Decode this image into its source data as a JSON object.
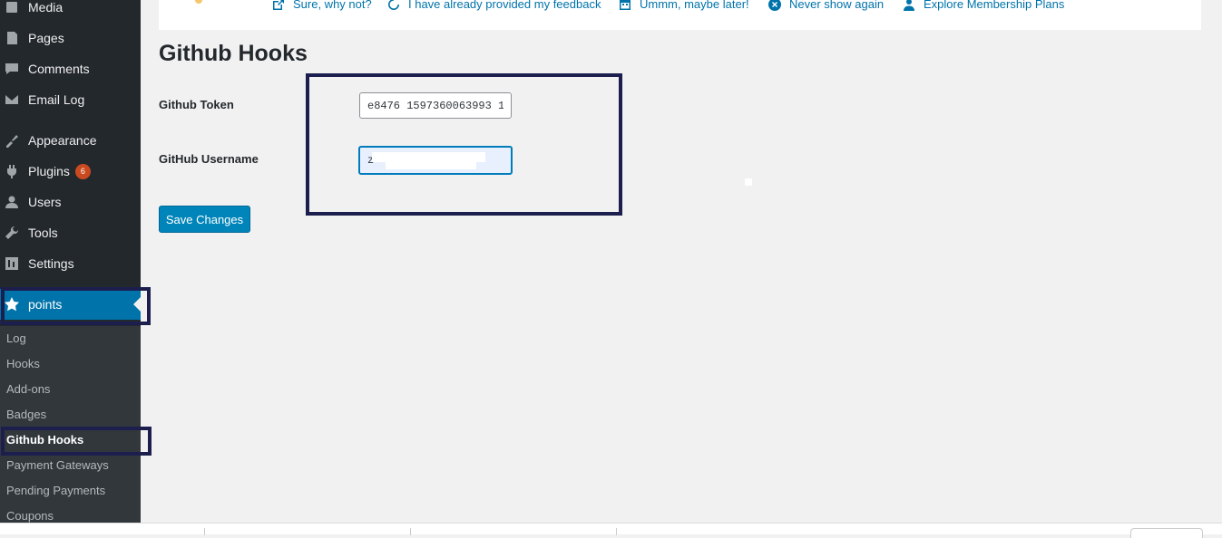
{
  "sidebar": {
    "menu": [
      {
        "label": "Media",
        "icon": "media-icon"
      },
      {
        "label": "Pages",
        "icon": "pages-icon"
      },
      {
        "label": "Comments",
        "icon": "comments-icon"
      },
      {
        "label": "Email Log",
        "icon": "email-icon"
      },
      {
        "label": "Appearance",
        "icon": "appearance-icon"
      },
      {
        "label": "Plugins",
        "icon": "plugins-icon",
        "badge": "6"
      },
      {
        "label": "Users",
        "icon": "users-icon"
      },
      {
        "label": "Tools",
        "icon": "tools-icon"
      },
      {
        "label": "Settings",
        "icon": "settings-icon"
      },
      {
        "label": "points",
        "icon": "star-icon"
      }
    ],
    "submenu": [
      "Log",
      "Hooks",
      "Add-ons",
      "Badges",
      "Github Hooks",
      "Payment Gateways",
      "Pending Payments",
      "Coupons"
    ]
  },
  "notice": {
    "links": [
      {
        "label": "Sure, why not?",
        "icon": "external-link-icon"
      },
      {
        "label": "I have already provided my feedback",
        "icon": "refresh-icon"
      },
      {
        "label": "Ummm, maybe later!",
        "icon": "calendar-icon"
      },
      {
        "label": "Never show again",
        "icon": "close-circle-icon"
      },
      {
        "label": "Explore Membership Plans",
        "icon": "users-icon"
      }
    ]
  },
  "main": {
    "title": "Github Hooks",
    "token_label": "Github Token",
    "token_value": "e8476 1597360063993 1",
    "username_label": "GitHub Username",
    "username_value": "z",
    "save_label": "Save Changes"
  },
  "colors": {
    "accent": "#0073aa",
    "sidebar": "#23282d",
    "highlight": "#1c1f4e",
    "badge": "#ca4a1f"
  }
}
